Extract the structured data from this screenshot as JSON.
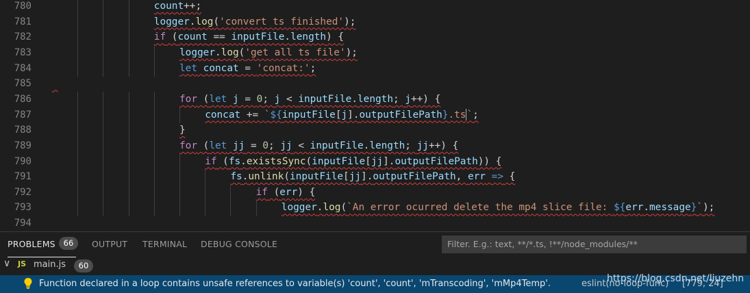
{
  "editor": {
    "lines": [
      {
        "n": "780",
        "indent": 4,
        "tokens": [
          [
            "vr",
            "count"
          ],
          [
            "op",
            "++;"
          ]
        ]
      },
      {
        "n": "781",
        "indent": 4,
        "tokens": [
          [
            "vr",
            "logger"
          ],
          [
            "op",
            "."
          ],
          [
            "fn",
            "log"
          ],
          [
            "op",
            "("
          ],
          [
            "str",
            "'convert ts finished'"
          ],
          [
            "op",
            ");"
          ]
        ]
      },
      {
        "n": "782",
        "indent": 4,
        "tokens": [
          [
            "kw",
            "if"
          ],
          [
            "op",
            " ("
          ],
          [
            "vr",
            "count"
          ],
          [
            "op",
            " == "
          ],
          [
            "vr",
            "inputFile"
          ],
          [
            "op",
            "."
          ],
          [
            "vr",
            "length"
          ],
          [
            "op",
            ") {"
          ]
        ]
      },
      {
        "n": "783",
        "indent": 5,
        "tokens": [
          [
            "vr",
            "logger"
          ],
          [
            "op",
            "."
          ],
          [
            "fn",
            "log"
          ],
          [
            "op",
            "("
          ],
          [
            "str",
            "'get all ts file'"
          ],
          [
            "op",
            ");"
          ]
        ]
      },
      {
        "n": "784",
        "indent": 5,
        "tokens": [
          [
            "st",
            "let"
          ],
          [
            "op",
            " "
          ],
          [
            "vr",
            "concat"
          ],
          [
            "op",
            " = "
          ],
          [
            "str",
            "'concat:'"
          ],
          [
            "op",
            ";"
          ]
        ]
      },
      {
        "n": "785",
        "indent": 0,
        "tokens": [
          [
            "op",
            " "
          ]
        ]
      },
      {
        "n": "786",
        "indent": 5,
        "tokens": [
          [
            "kw",
            "for"
          ],
          [
            "op",
            " ("
          ],
          [
            "st",
            "let"
          ],
          [
            "op",
            " "
          ],
          [
            "vr",
            "j"
          ],
          [
            "op",
            " = "
          ],
          [
            "num",
            "0"
          ],
          [
            "op",
            "; "
          ],
          [
            "vr",
            "j"
          ],
          [
            "op",
            " < "
          ],
          [
            "vr",
            "inputFile"
          ],
          [
            "op",
            "."
          ],
          [
            "vr",
            "length"
          ],
          [
            "op",
            "; "
          ],
          [
            "vr",
            "j"
          ],
          [
            "op",
            "++) {"
          ]
        ]
      },
      {
        "n": "787",
        "indent": 6,
        "tokens": [
          [
            "vr",
            "concat"
          ],
          [
            "op",
            " += "
          ],
          [
            "str",
            "`"
          ],
          [
            "st",
            "${"
          ],
          [
            "vr",
            "inputFile"
          ],
          [
            "op",
            "["
          ],
          [
            "vr",
            "j"
          ],
          [
            "op",
            "]."
          ],
          [
            "vr",
            "outputFilePath"
          ],
          [
            "st",
            "}"
          ],
          [
            "str",
            ".ts"
          ],
          [
            "cur",
            ""
          ],
          [
            "str",
            "`"
          ],
          [
            "op",
            ";"
          ]
        ]
      },
      {
        "n": "788",
        "indent": 5,
        "tokens": [
          [
            "op",
            "}"
          ]
        ]
      },
      {
        "n": "789",
        "indent": 5,
        "tokens": [
          [
            "kw",
            "for"
          ],
          [
            "op",
            " ("
          ],
          [
            "st",
            "let"
          ],
          [
            "op",
            " "
          ],
          [
            "vr",
            "jj"
          ],
          [
            "op",
            " = "
          ],
          [
            "num",
            "0"
          ],
          [
            "op",
            "; "
          ],
          [
            "vr",
            "jj"
          ],
          [
            "op",
            " < "
          ],
          [
            "vr",
            "inputFile"
          ],
          [
            "op",
            "."
          ],
          [
            "vr",
            "length"
          ],
          [
            "op",
            "; "
          ],
          [
            "vr",
            "jj"
          ],
          [
            "op",
            "++) {"
          ]
        ]
      },
      {
        "n": "790",
        "indent": 6,
        "tokens": [
          [
            "kw",
            "if"
          ],
          [
            "op",
            " ("
          ],
          [
            "vr",
            "fs"
          ],
          [
            "op",
            "."
          ],
          [
            "fn",
            "existsSync"
          ],
          [
            "op",
            "("
          ],
          [
            "vr",
            "inputFile"
          ],
          [
            "op",
            "["
          ],
          [
            "vr",
            "jj"
          ],
          [
            "op",
            "]."
          ],
          [
            "vr",
            "outputFilePath"
          ],
          [
            "op",
            ")) {"
          ]
        ]
      },
      {
        "n": "791",
        "indent": 7,
        "tokens": [
          [
            "vr",
            "fs"
          ],
          [
            "op",
            "."
          ],
          [
            "fn",
            "unlink"
          ],
          [
            "op",
            "("
          ],
          [
            "vr",
            "inputFile"
          ],
          [
            "op",
            "["
          ],
          [
            "vr",
            "jj"
          ],
          [
            "op",
            "]."
          ],
          [
            "vr",
            "outputFilePath"
          ],
          [
            "op",
            ", "
          ],
          [
            "vr",
            "err"
          ],
          [
            "op",
            " "
          ],
          [
            "st",
            "=>"
          ],
          [
            "op",
            " {"
          ]
        ]
      },
      {
        "n": "792",
        "indent": 8,
        "tokens": [
          [
            "kw",
            "if"
          ],
          [
            "op",
            " ("
          ],
          [
            "vr",
            "err"
          ],
          [
            "op",
            ") {"
          ]
        ]
      },
      {
        "n": "793",
        "indent": 9,
        "tokens": [
          [
            "vr",
            "logger"
          ],
          [
            "op",
            "."
          ],
          [
            "fn",
            "log"
          ],
          [
            "op",
            "("
          ],
          [
            "str",
            "`An error ocurred delete the mp4 slice file: "
          ],
          [
            "st",
            "${"
          ],
          [
            "vr",
            "err"
          ],
          [
            "op",
            "."
          ],
          [
            "vr",
            "message"
          ],
          [
            "st",
            "}"
          ],
          [
            "str",
            "`"
          ],
          [
            "op",
            ");"
          ]
        ]
      },
      {
        "n": "794",
        "indent": 0,
        "tokens": []
      }
    ]
  },
  "panel": {
    "tabs": {
      "problems": "PROBLEMS",
      "problems_count": "66",
      "output": "OUTPUT",
      "terminal": "TERMINAL",
      "debug_console": "DEBUG CONSOLE"
    },
    "filter_placeholder": "Filter. E.g.: text, **/*.ts, !**/node_modules/**",
    "file": {
      "chevron": "∨",
      "lang_badge": "JS",
      "name": "main.js",
      "count": "60"
    },
    "problem": {
      "icon": "lightbulb-icon",
      "message": "Function declared in a loop contains unsafe references to variable(s) 'count', 'count', 'mTranscoding', 'mMp4Temp'.",
      "source": "eslint(no-loop-func)",
      "position": "[779, 24]"
    },
    "watermark": "https://blog.csdn.net/liuzehn"
  }
}
